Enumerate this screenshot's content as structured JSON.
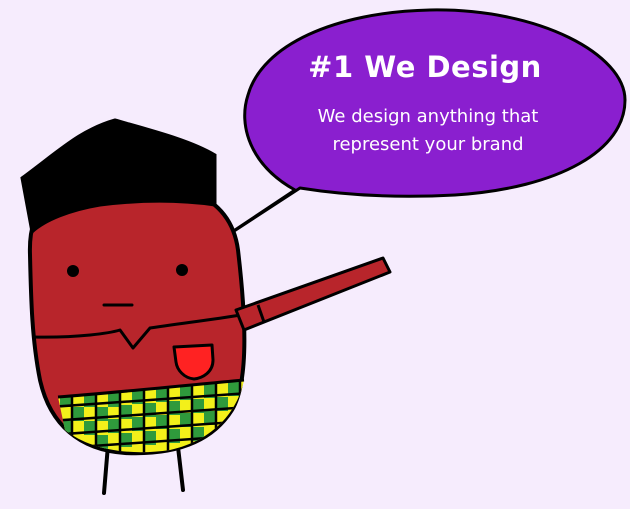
{
  "speech_bubble": {
    "title": "#1 We Design",
    "line1": "We design anything that",
    "line2": "represent your brand"
  },
  "colors": {
    "background": "#f6ecfd",
    "bubble": "#8a1fcf",
    "body": "#b8252b",
    "hat": "#000000",
    "plaid_yellow": "#f3f01a",
    "plaid_green": "#2f9a3c",
    "pocket": "#ff2222"
  },
  "icons": [
    "mascot-character",
    "speech-bubble"
  ]
}
